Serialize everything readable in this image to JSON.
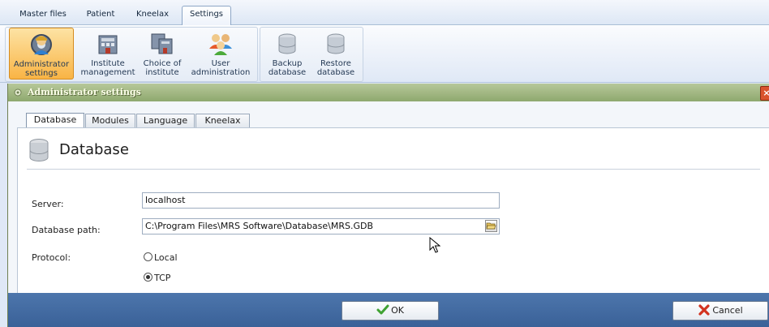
{
  "menu": {
    "tabs": [
      "Master files",
      "Patient",
      "Kneelax",
      "Settings"
    ],
    "active": "Settings"
  },
  "ribbon": {
    "buttons": [
      {
        "line1": "Administrator",
        "line2": "settings",
        "icon": "admin-settings-icon"
      },
      {
        "line1": "Institute",
        "line2": "management",
        "icon": "institute-icon"
      },
      {
        "line1": "Choice of",
        "line2": "institute",
        "icon": "choice-institute-icon"
      },
      {
        "line1": "User",
        "line2": "administration",
        "icon": "users-icon"
      },
      {
        "line1": "Backup",
        "line2": "database",
        "icon": "database-icon"
      },
      {
        "line1": "Restore",
        "line2": "database",
        "icon": "database-icon"
      }
    ]
  },
  "dialog": {
    "title": "Administrator settings",
    "close_icon": "close-icon",
    "tabs": [
      "Database",
      "Modules",
      "Language",
      "Kneelax"
    ],
    "active_tab": "Database",
    "section_title": "Database",
    "server_label": "Server:",
    "server_value": "localhost",
    "path_label": "Database path:",
    "path_value": "C:\\Program Files\\MRS Software\\Database\\MRS.GDB",
    "protocol_label": "Protocol:",
    "protocol_options": [
      "Local",
      "TCP"
    ],
    "protocol_selected": "TCP",
    "ok_label": "OK",
    "cancel_label": "Cancel"
  },
  "colors": {
    "accent_active": "#f9b445",
    "title_bar": "#8ea86e",
    "footer": "#3a6198"
  }
}
